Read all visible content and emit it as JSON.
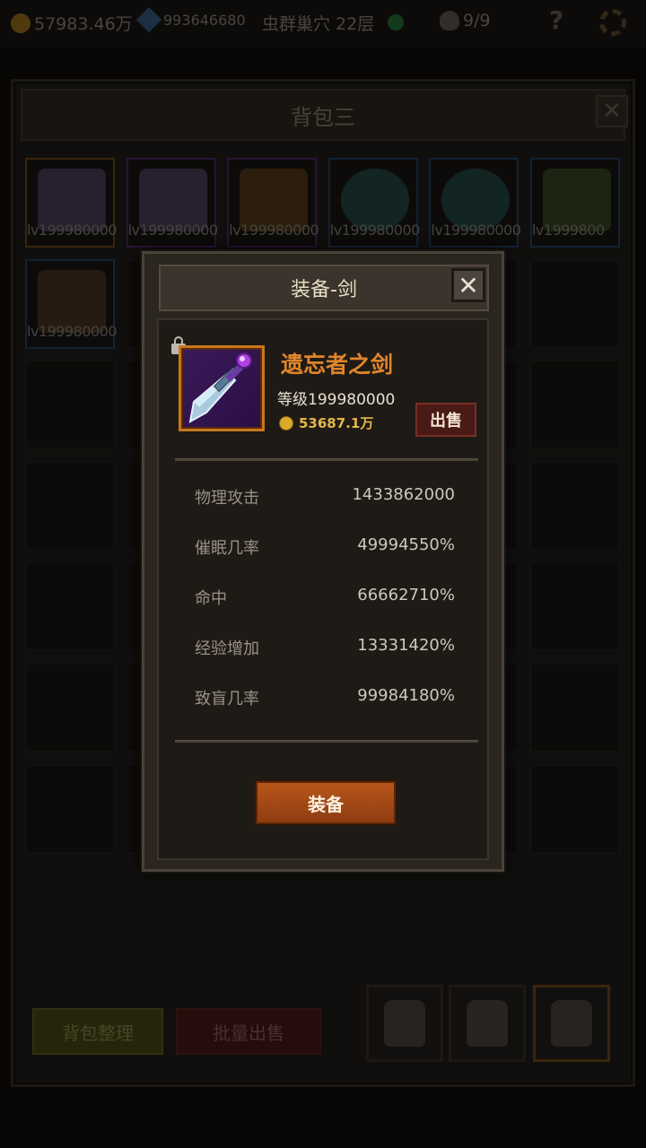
{
  "topbar": {
    "gold": "57983.46万",
    "gems": "993646680",
    "stage": "虫群巢穴 22层",
    "monsters": "9/9",
    "help": "?"
  },
  "bag": {
    "title": "背包三",
    "close": "✕",
    "items": [
      {
        "level": "lv199980000",
        "icon": "sword-icon",
        "border": "orange"
      },
      {
        "level": "lv199980000",
        "icon": "sword-icon",
        "border": "purple"
      },
      {
        "level": "lv199980000",
        "icon": "helmet-icon",
        "border": "purple"
      },
      {
        "level": "lv199980000",
        "icon": "orb-icon",
        "border": "blue"
      },
      {
        "level": "lv199980000",
        "icon": "orb-icon",
        "border": "blue"
      },
      {
        "level": "lv1999800",
        "icon": "gun-icon",
        "border": "blue"
      },
      {
        "level": "lv199980000",
        "icon": "feather-icon",
        "border": "blue"
      }
    ],
    "sort_label": "背包整理",
    "batch_sell_label": "批量出售"
  },
  "modal": {
    "title": "装备-剑",
    "close": "✕",
    "item_name": "遗忘者之剑",
    "level": "等级199980000",
    "price": "53687.1万",
    "sell_label": "出售",
    "stats": [
      {
        "label": "物理攻击",
        "value": "1433862000"
      },
      {
        "label": "催眠几率",
        "value": "49994550%"
      },
      {
        "label": "命中",
        "value": "66662710%"
      },
      {
        "label": "经验增加",
        "value": "13331420%"
      },
      {
        "label": "致盲几率",
        "value": "99984180%"
      }
    ],
    "equip_label": "装备"
  },
  "colors": {
    "item_name": "#e0852a",
    "price": "#e4b84a",
    "rare_border": "#c8761e"
  }
}
